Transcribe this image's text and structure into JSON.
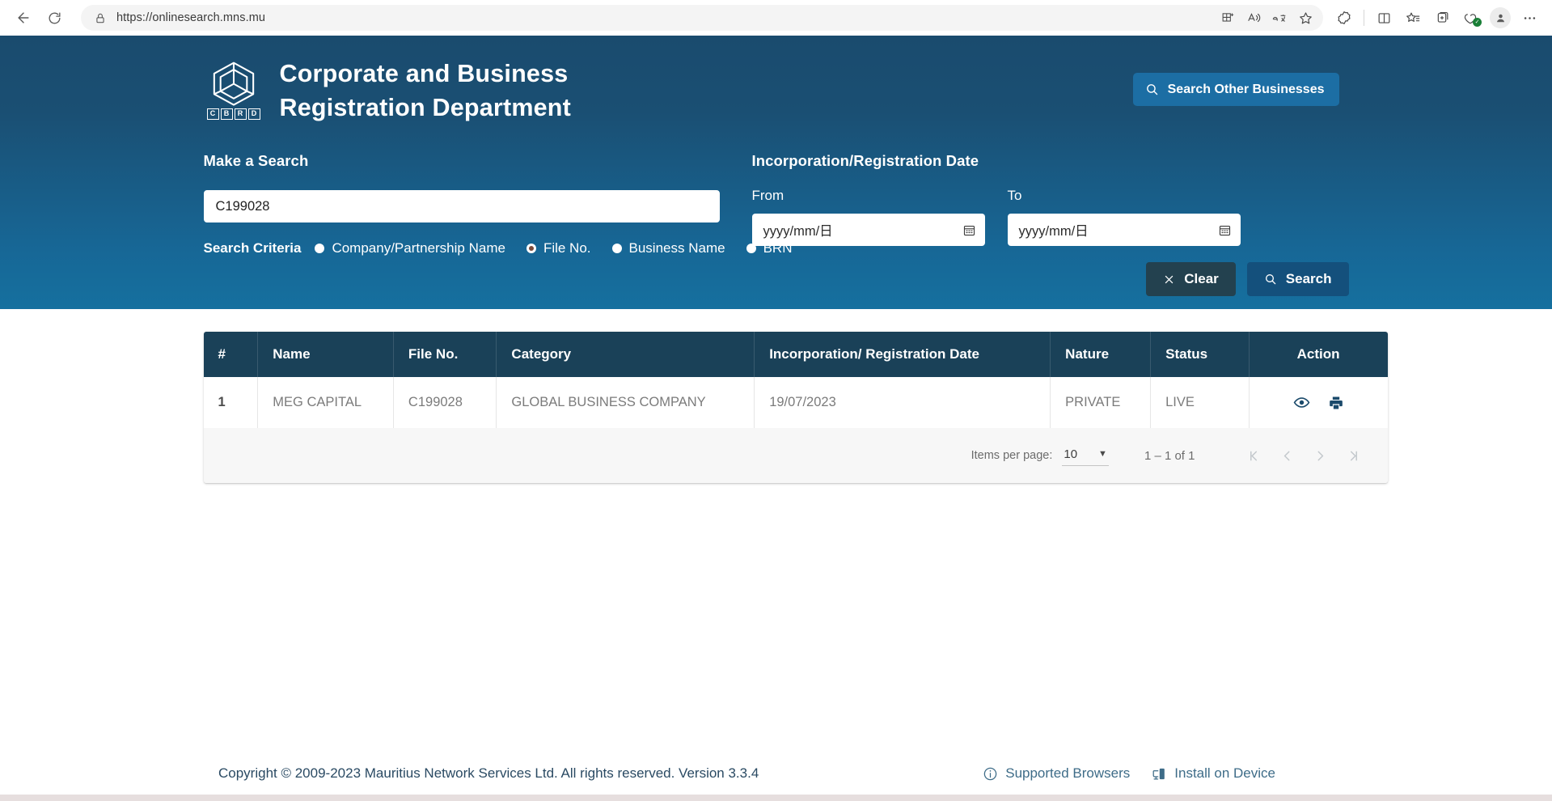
{
  "browser": {
    "back_label": "Back",
    "reload_label": "Refresh",
    "url": "https://onlinesearch.mns.mu",
    "lock_icon": "lock-icon",
    "omnibox_icons": [
      "split-screen-add-icon",
      "read-aloud-icon",
      "translate-icon",
      "favorite-star-icon"
    ],
    "toolbar_icons": [
      "copilot-icon",
      "split-screen-icon",
      "collections-favorites-icon",
      "add-to-collections-icon",
      "browser-essentials-icon",
      "profile-icon",
      "settings-more-icon"
    ]
  },
  "header": {
    "logo_alt": "CBRD cube logo",
    "logo_letters": [
      "C",
      "B",
      "R",
      "D"
    ],
    "title_line1": "Corporate and Business",
    "title_line2": "Registration Department",
    "search_other_label": "Search Other Businesses"
  },
  "search": {
    "make_a_search_label": "Make a Search",
    "query_value": "C199028",
    "criteria_label": "Search Criteria",
    "criteria_options": [
      {
        "label": "Company/Partnership Name",
        "selected": false
      },
      {
        "label": "File No.",
        "selected": true
      },
      {
        "label": "Business Name",
        "selected": false
      },
      {
        "label": "BRN",
        "selected": false
      }
    ],
    "date_section_label": "Incorporation/Registration Date",
    "from_label": "From",
    "to_label": "To",
    "date_placeholder": "yyyy/mm/日",
    "from_value": "",
    "to_value": "",
    "clear_label": "Clear",
    "search_label": "Search"
  },
  "results": {
    "columns": [
      "#",
      "Name",
      "File No.",
      "Category",
      "Incorporation/ Registration Date",
      "Nature",
      "Status",
      "Action"
    ],
    "rows": [
      {
        "index": "1",
        "name": "MEG CAPITAL",
        "file_no": "C199028",
        "category": "GLOBAL BUSINESS COMPANY",
        "date": "19/07/2023",
        "nature": "PRIVATE",
        "status": "LIVE",
        "actions": [
          "view-icon",
          "print-icon"
        ]
      }
    ],
    "paginator": {
      "items_per_page_label": "Items per page:",
      "items_per_page_value": "10",
      "range_label": "1 – 1 of 1",
      "first_page": "first-page-icon",
      "prev_page": "previous-page-icon",
      "next_page": "next-page-icon",
      "last_page": "last-page-icon"
    }
  },
  "footer": {
    "copyright": "Copyright © 2009-2023 Mauritius Network Services Ltd. All rights reserved. Version 3.3.4",
    "supported_browsers_label": "Supported Browsers",
    "install_label": "Install on Device"
  },
  "colors": {
    "hero_top": "#1a4b6e",
    "hero_bottom": "#15709f",
    "accent_button": "#1c6ea4",
    "table_header": "#1a4158",
    "clear_button": "#23414f",
    "search_button": "#14507c",
    "footer_link": "#3e6c88"
  }
}
